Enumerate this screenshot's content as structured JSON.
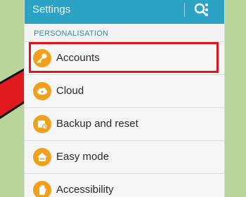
{
  "header": {
    "title": "Settings",
    "search_icon": "search-icon",
    "more_icon": "more-vert-icon"
  },
  "section": {
    "label": "PERSONALISATION"
  },
  "items": [
    {
      "label": "Accounts",
      "icon": "key-icon"
    },
    {
      "label": "Cloud",
      "icon": "cloud-icon"
    },
    {
      "label": "Backup and reset",
      "icon": "backup-icon"
    },
    {
      "label": "Easy mode",
      "icon": "easy-mode-icon"
    },
    {
      "label": "Accessibility",
      "icon": "hand-icon"
    }
  ],
  "colors": {
    "topbar": "#2aa3c4",
    "icon_bg": "#efa11e",
    "highlight": "#e0141e",
    "arrow": "#e01a1f",
    "background": "#b9d59b"
  }
}
